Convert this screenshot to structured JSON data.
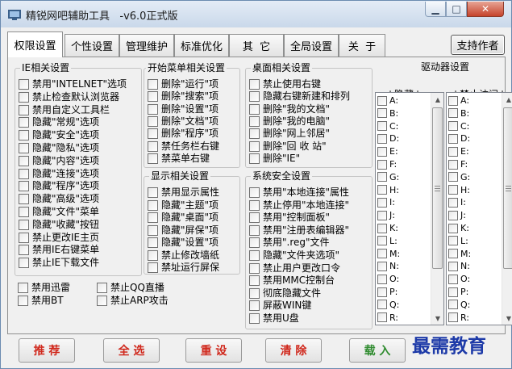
{
  "window": {
    "title": "精锐网吧辅助工具   -v6.0正式版"
  },
  "tabs": [
    {
      "label": "权限设置"
    },
    {
      "label": "个性设置"
    },
    {
      "label": "管理维护"
    },
    {
      "label": "标准优化"
    },
    {
      "label": "其  它"
    },
    {
      "label": "全局设置"
    },
    {
      "label": "关  于"
    }
  ],
  "help_button": "支持作者",
  "ie_group": {
    "title": "IE相关设置",
    "items": [
      "禁用\"INTELNET\"选项",
      "禁止检查默认浏览器",
      "禁用自定义工具栏",
      "隐藏\"常规\"选项",
      "隐藏\"安全\"选项",
      "隐藏\"隐私\"选项",
      "隐藏\"内容\"选项",
      "隐藏\"连接\"选项",
      "隐藏\"程序\"选项",
      "隐藏\"高级\"选项",
      "隐藏\"文件\"菜单",
      "隐藏\"收藏\"按钮",
      "禁止更改IE主页",
      "禁用IE右键菜单",
      "禁止IE下载文件"
    ]
  },
  "misc_items": [
    "禁用迅雷",
    "禁止QQ直播",
    "禁用BT",
    "禁止ARP攻击"
  ],
  "start_group": {
    "title": "开始菜单相关设置",
    "items": [
      "删除\"运行\"项",
      "删除\"搜索\"项",
      "删除\"设置\"项",
      "删除\"文档\"项",
      "删除\"程序\"项",
      "禁任务栏右键",
      "禁菜单右键"
    ]
  },
  "display_group": {
    "title": "显示相关设置",
    "items": [
      "禁用显示属性",
      "隐藏\"主题\"项",
      "隐藏\"桌面\"项",
      "隐藏\"屏保\"项",
      "隐藏\"设置\"项",
      "禁止修改墙纸",
      "禁址运行屏保"
    ]
  },
  "desktop_group": {
    "title": "桌面相关设置",
    "items": [
      "禁止使用右键",
      "隐藏右键新建和排列",
      "删除\"我的文档\"",
      "删除\"我的电脑\"",
      "删除\"网上邻居\"",
      "删除\"回 收 站\"",
      "删除\"IE\""
    ]
  },
  "security_group": {
    "title": "系统安全设置",
    "items": [
      "禁用\"本地连接\"属性",
      "禁止停用\"本地连接\"",
      "禁用\"控制面板\"",
      "禁用\"注册表编辑器\"",
      "禁用\".reg\"文件",
      "隐藏\"文件夹选项\"",
      "禁止用户更改口令",
      "禁用MMC控制台",
      "彻底隐藏文件",
      "屏蔽WIN键",
      "禁用U盘"
    ]
  },
  "drive_group": {
    "title": "驱动器设置",
    "hide_header": "↓隐藏↓",
    "block_header": "↓禁止访问↓",
    "drives": [
      "A:",
      "B:",
      "C:",
      "D:",
      "E:",
      "F:",
      "G:",
      "H:",
      "I:",
      "J:",
      "K:",
      "L:",
      "M:",
      "N:",
      "O:",
      "P:",
      "Q:",
      "R:"
    ]
  },
  "bottom_buttons": [
    {
      "label": "推 荐",
      "color": "#d0281c"
    },
    {
      "label": "全 选",
      "color": "#d0281c"
    },
    {
      "label": "重 设",
      "color": "#d0281c"
    },
    {
      "label": "清 除",
      "color": "#d0281c"
    },
    {
      "label": "载 入",
      "color": "#2e8b2e"
    }
  ],
  "watermark": "最需教育"
}
